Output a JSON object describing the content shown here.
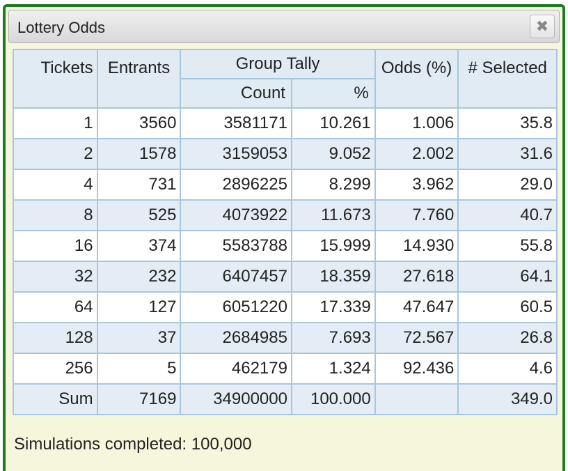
{
  "dialog": {
    "title": "Lottery Odds",
    "close_glyph": "✖",
    "status_text": "Simulations completed: 100,000"
  },
  "table": {
    "headers": {
      "tickets": "Tickets",
      "entrants": "Entrants",
      "group_tally": "Group Tally",
      "count": "Count",
      "percent": "%",
      "odds": "Odds (%)",
      "selected": "# Selected"
    },
    "rows": [
      [
        "1",
        "3560",
        "3581171",
        "10.261",
        "1.006",
        "35.8"
      ],
      [
        "2",
        "1578",
        "3159053",
        "9.052",
        "2.002",
        "31.6"
      ],
      [
        "4",
        "731",
        "2896225",
        "8.299",
        "3.962",
        "29.0"
      ],
      [
        "8",
        "525",
        "4073922",
        "11.673",
        "7.760",
        "40.7"
      ],
      [
        "16",
        "374",
        "5583788",
        "15.999",
        "14.930",
        "55.8"
      ],
      [
        "32",
        "232",
        "6407457",
        "18.359",
        "27.618",
        "64.1"
      ],
      [
        "64",
        "127",
        "6051220",
        "17.339",
        "47.647",
        "60.5"
      ],
      [
        "128",
        "37",
        "2684985",
        "7.693",
        "72.567",
        "26.8"
      ],
      [
        "256",
        "5",
        "462179",
        "1.324",
        "92.436",
        "4.6"
      ],
      [
        "Sum",
        "7169",
        "34900000",
        "100.000",
        "",
        "349.0"
      ]
    ]
  },
  "colors": {
    "frame_border": "#1e7a1e",
    "panel_background": "#f6f6dc",
    "header_background": "#e0ebf4",
    "stripe_background": "#e4edf6",
    "cell_border": "#a9c7dc"
  }
}
